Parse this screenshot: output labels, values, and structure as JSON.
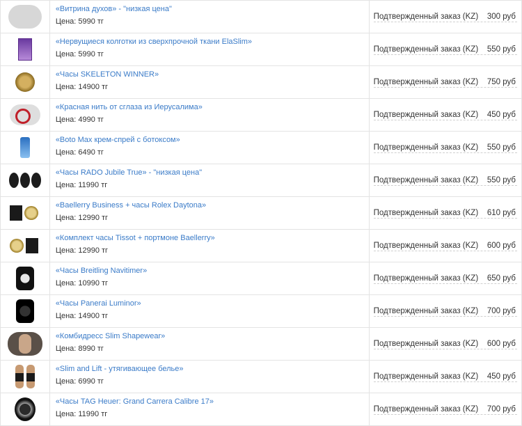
{
  "price_label": "Цена:",
  "status_text": "Подтвержденный заказ (KZ)",
  "rows": [
    {
      "title": "«Витрина духов» - \"низкая цена\"",
      "price": "Цена: 5990 тг",
      "status": "Подтвержденный заказ (KZ)",
      "reward": "300 руб",
      "thumb": "perfume-icon"
    },
    {
      "title": "«Нервущиеся колготки из сверхпрочной ткани ElaSlim»",
      "price": "Цена: 5990 тг",
      "status": "Подтвержденный заказ (KZ)",
      "reward": "550 руб",
      "thumb": "tights-box-icon"
    },
    {
      "title": "«Часы SKELETON WINNER»",
      "price": "Цена: 14900 тг",
      "status": "Подтвержденный заказ (KZ)",
      "reward": "750 руб",
      "thumb": "gold-watch-icon"
    },
    {
      "title": "«Красная нить от сглаза из Иерусалима»",
      "price": "Цена: 4990 тг",
      "status": "Подтвержденный заказ (KZ)",
      "reward": "450 руб",
      "thumb": "red-thread-icon"
    },
    {
      "title": "«Boto Max крем-спрей с ботоксом»",
      "price": "Цена: 6490 тг",
      "status": "Подтвержденный заказ (KZ)",
      "reward": "550 руб",
      "thumb": "spray-icon"
    },
    {
      "title": "«Часы RADO Jubile True» - \"низкая цена\"",
      "price": "Цена: 11990 тг",
      "status": "Подтвержденный заказ (KZ)",
      "reward": "550 руб",
      "thumb": "three-watches-icon"
    },
    {
      "title": "«Baellerry Business + часы Rolex Daytona»",
      "price": "Цена: 12990 тг",
      "status": "Подтвержденный заказ (KZ)",
      "reward": "610 руб",
      "thumb": "wallet-watch-icon"
    },
    {
      "title": "«Комплект часы Tissot + портмоне Baellerry»",
      "price": "Цена: 12990 тг",
      "status": "Подтвержденный заказ (KZ)",
      "reward": "600 руб",
      "thumb": "watch-wallet-icon"
    },
    {
      "title": "«Часы Breitling Navitimer»",
      "price": "Цена: 10990 тг",
      "status": "Подтвержденный заказ (KZ)",
      "reward": "650 руб",
      "thumb": "black-watch-icon"
    },
    {
      "title": "«Часы Panerai Luminor»",
      "price": "Цена: 14900 тг",
      "status": "Подтвержденный заказ (KZ)",
      "reward": "700 руб",
      "thumb": "dark-watch-icon"
    },
    {
      "title": "«Комбидресс Slim Shapewear»",
      "price": "Цена: 8990 тг",
      "status": "Подтвержденный заказ (KZ)",
      "reward": "600 руб",
      "thumb": "shapewear-icon"
    },
    {
      "title": "«Slim and Lift - утягивающее белье»",
      "price": "Цена: 6990 тг",
      "status": "Подтвержденный заказ (KZ)",
      "reward": "450 руб",
      "thumb": "women-icon"
    },
    {
      "title": "«Часы TAG Heuer: Grand Carrera Calibre 17»",
      "price": "Цена: 11990 тг",
      "status": "Подтвержденный заказ (KZ)",
      "reward": "700 руб",
      "thumb": "tag-watch-icon"
    }
  ],
  "colors": {
    "link": "#3a7bc8",
    "text": "#333333",
    "border": "#e3e3e3"
  }
}
